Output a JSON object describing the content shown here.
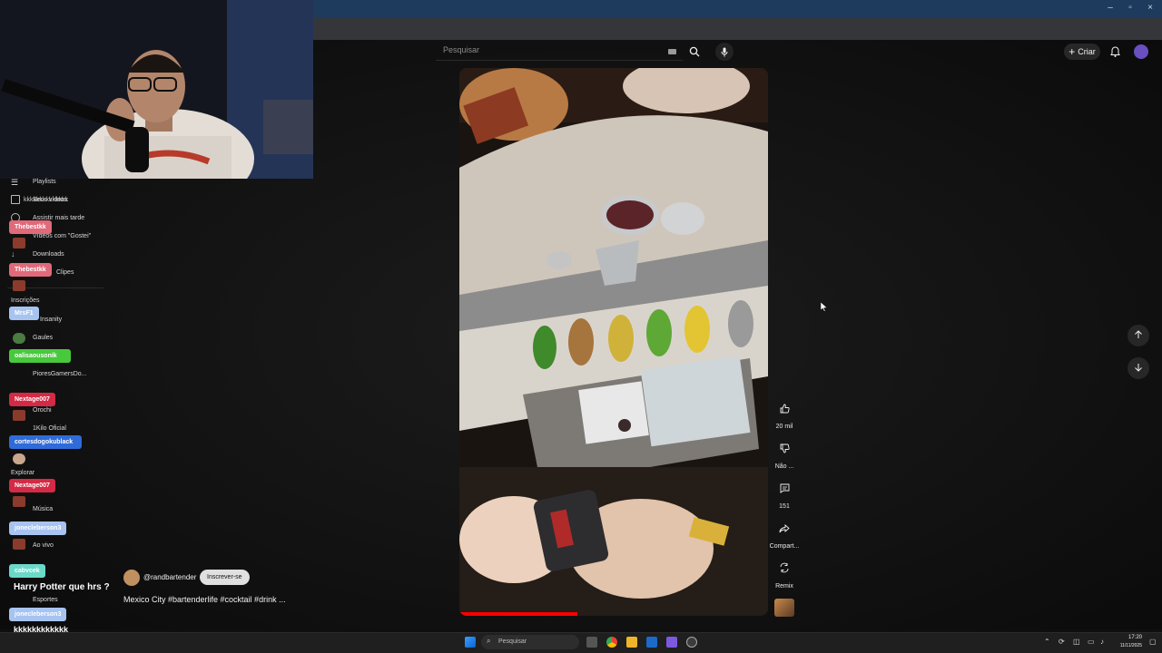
{
  "browser": {
    "window_buttons": [
      "–",
      "▫",
      "×"
    ]
  },
  "header": {
    "search_placeholder": "Pesquisar",
    "create_label": "Criar"
  },
  "sidebar": {
    "items": [
      {
        "label": "Playlists",
        "icon": "playlist-icon"
      },
      {
        "label": "Seus vídeos",
        "icon": "video-icon"
      },
      {
        "label": "Assistir mais tarde",
        "icon": "clock-icon"
      },
      {
        "label": "Vídeos com \"Gostei\"",
        "icon": "like-icon"
      },
      {
        "label": "Downloads",
        "icon": "download-icon"
      },
      {
        "label": "Clipes",
        "icon": "scissors-icon"
      }
    ],
    "subscriptions_title": "Inscrições",
    "subscriptions": [
      {
        "label": "Insanity"
      },
      {
        "label": "Gaules"
      },
      {
        "label": "PioresGamersDo..."
      },
      {
        "label": "Orochi"
      },
      {
        "label": "1Kilo Oficial"
      }
    ],
    "explore_title": "Explorar",
    "explore_items": [
      {
        "label": "Música"
      },
      {
        "label": "Ao vivo"
      },
      {
        "label": "Esportes"
      }
    ]
  },
  "chat": {
    "messages": [
      {
        "user": "",
        "text": "kkkkkkkkkkkkkk"
      },
      {
        "user": "Thebestkk",
        "color": "#e06a7a"
      },
      {
        "user": "Thebestkk",
        "color": "#e06a7a"
      },
      {
        "user": "MrsF1",
        "color": "#a7c3f0"
      },
      {
        "user": "oalisaousonik",
        "color": "#48c93c"
      },
      {
        "user": "Nextage007",
        "color": "#d42a45"
      },
      {
        "user": "cortesdogokublack",
        "color": "#2f6bd9"
      },
      {
        "user": "Nextage007",
        "color": "#d42a45"
      },
      {
        "user": "jonecleberson3",
        "color": "#a7c3f0"
      },
      {
        "user": "cabvcek",
        "color": "#6ad9c9"
      },
      {
        "user": "",
        "text": "Harry Potter que hrs ?"
      },
      {
        "user": "jonecleberson3",
        "color": "#a7c3f0"
      },
      {
        "user": "",
        "text": "kkkkkkkkkkkk"
      }
    ]
  },
  "short": {
    "channel": "@randbartender",
    "subscribe_label": "Inscrever-se",
    "title": "Mexico City #bartenderlife #cocktail #drink ..."
  },
  "actions": [
    {
      "label": "20 mil",
      "icon": "thumbs-up-icon"
    },
    {
      "label": "Não ...",
      "icon": "thumbs-down-icon"
    },
    {
      "label": "151",
      "icon": "comment-icon"
    },
    {
      "label": "Compart...",
      "icon": "share-icon"
    },
    {
      "label": "Remix",
      "icon": "remix-icon"
    }
  ],
  "taskbar": {
    "search_placeholder": "Pesquisar",
    "time": "17:20",
    "date": "11/11/2025"
  },
  "colors": {
    "accent": "#ff0000",
    "background": "#0f0f0f",
    "titlebar": "#1e3a5c"
  }
}
